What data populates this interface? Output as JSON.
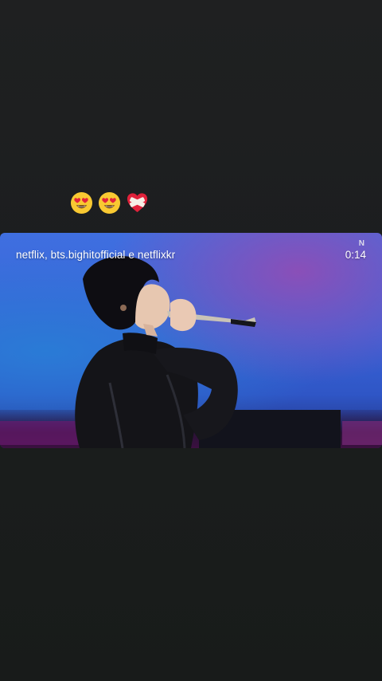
{
  "story": {
    "reaction_emojis": [
      "heart-eyes-emoji",
      "heart-eyes-emoji",
      "mending-heart-emoji"
    ],
    "colors": {
      "background": "#1e1f20",
      "video_sky": "#3a64d8",
      "video_purple_glow": "#8a4fb8"
    }
  },
  "video": {
    "caption": "netflix, bts.bighitofficial e netflixkr",
    "brand_mark": "N",
    "timecode": "0:14"
  }
}
